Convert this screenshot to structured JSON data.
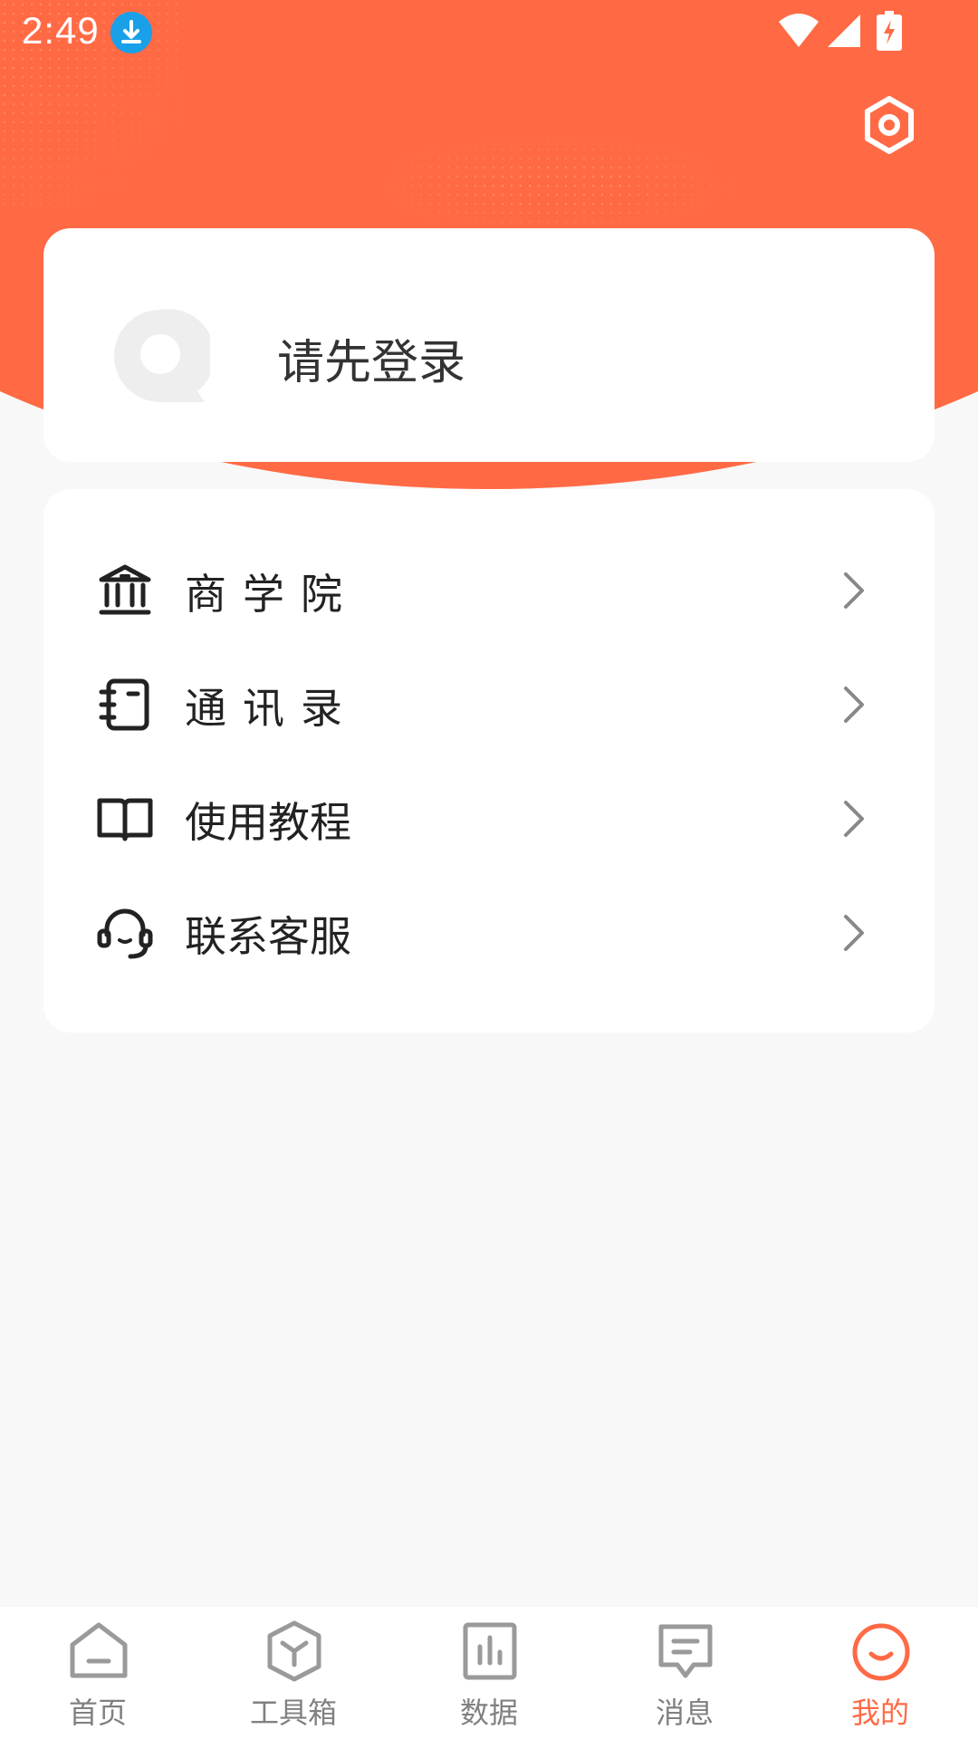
{
  "status_bar": {
    "time": "2:49"
  },
  "profile": {
    "login_prompt": "请先登录"
  },
  "menu": {
    "items": [
      {
        "label": "商学院",
        "icon": "bank-icon"
      },
      {
        "label": "通讯录",
        "icon": "contact-book-icon"
      },
      {
        "label": "使用教程",
        "icon": "book-icon"
      },
      {
        "label": "联系客服",
        "icon": "headset-icon"
      }
    ]
  },
  "tabbar": {
    "items": [
      {
        "label": "首页",
        "icon": "home-icon",
        "active": false
      },
      {
        "label": "工具箱",
        "icon": "toolbox-icon",
        "active": false
      },
      {
        "label": "数据",
        "icon": "chart-icon",
        "active": false
      },
      {
        "label": "消息",
        "icon": "message-icon",
        "active": false
      },
      {
        "label": "我的",
        "icon": "profile-icon",
        "active": true
      }
    ]
  },
  "colors": {
    "accent": "#ff6a45",
    "inactive": "#808080",
    "background": "#f8f8f8"
  }
}
